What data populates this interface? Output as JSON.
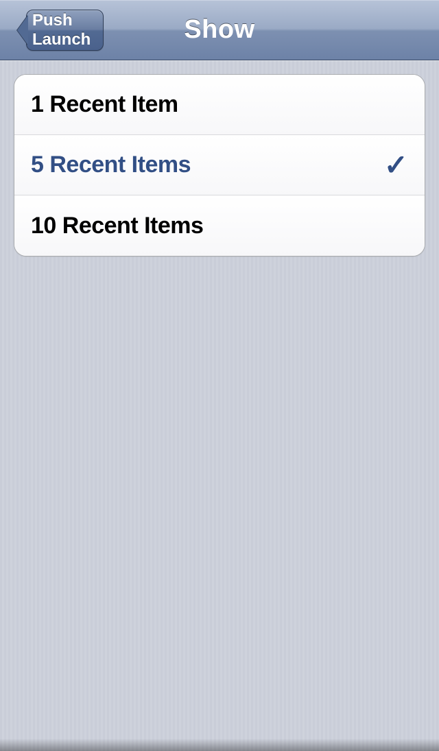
{
  "nav": {
    "back_label": "Push Launch",
    "title": "Show"
  },
  "options": [
    {
      "label": "1 Recent Item",
      "selected": false
    },
    {
      "label": "5 Recent Items",
      "selected": true
    },
    {
      "label": "10 Recent Items",
      "selected": false
    }
  ],
  "icons": {
    "checkmark": "✓"
  }
}
